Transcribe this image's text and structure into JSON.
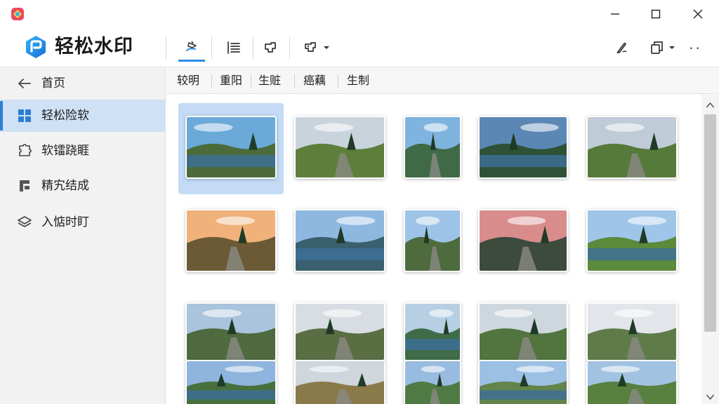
{
  "app": {
    "title": "轻松水印"
  },
  "window": {
    "minimize": "minimize-icon",
    "maximize": "maximize-icon",
    "close": "close-icon"
  },
  "toolbar": {
    "tools": [
      "watermark-brush-icon",
      "list-align-icon",
      "crop-frame-icon",
      "batch-frame-icon"
    ],
    "right": [
      "pen-icon",
      "copy-icon",
      "more-icon"
    ]
  },
  "sidebar": {
    "items": [
      {
        "label": "首页",
        "icon": "back-arrow-icon"
      },
      {
        "label": "轻松险软",
        "icon": "grid-icon"
      },
      {
        "label": "软镭跷睚",
        "icon": "puzzle-icon"
      },
      {
        "label": "精宄结成",
        "icon": "stamp-icon"
      },
      {
        "label": "入惦时盯",
        "icon": "layers-icon"
      }
    ]
  },
  "tabs": [
    "较明",
    "重阳",
    "生赃",
    "癌藕",
    "生制"
  ],
  "thumbnails_count": 20,
  "colors": {
    "accent": "#2b8be6",
    "selected": "#cfe1f5",
    "selectedThumbBg": "#c3dbf5"
  }
}
